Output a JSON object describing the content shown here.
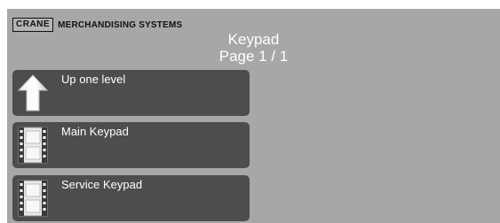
{
  "header": {
    "brand_box": "CRANE",
    "brand_text": "MERCHANDISING SYSTEMS",
    "title": "Keypad",
    "page": "Page 1 / 1"
  },
  "items": [
    {
      "label": "Up one level",
      "icon": "up-arrow-icon"
    },
    {
      "label": "Main Keypad",
      "icon": "film-strip-icon"
    },
    {
      "label": "Service Keypad",
      "icon": "film-strip-icon"
    }
  ],
  "colors": {
    "background": "#a7a7a7",
    "item_bg": "#4d4d4d",
    "text": "#ffffff"
  }
}
